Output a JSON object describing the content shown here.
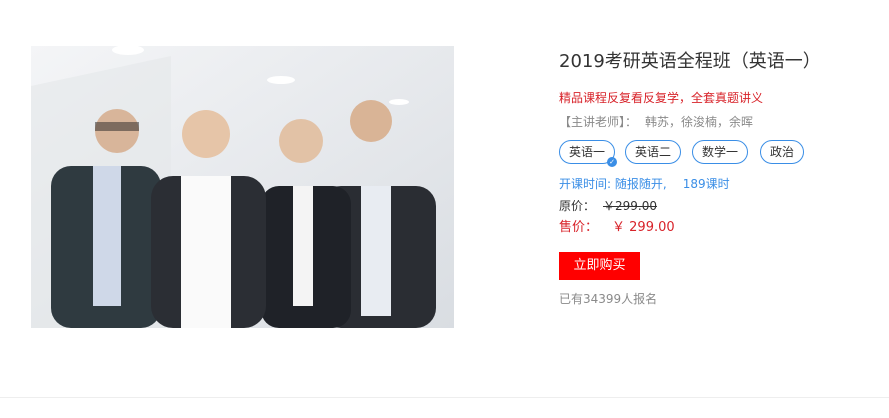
{
  "course": {
    "title": "2019考研英语全程班（英语一）",
    "subtitle": "精品课程反复看反复学，全套真题讲义",
    "teachers_label": "【主讲老师】：",
    "teachers": "韩苏，徐浚楠，余晖",
    "tags": [
      {
        "label": "英语一",
        "selected": true
      },
      {
        "label": "英语二",
        "selected": false
      },
      {
        "label": "数学一",
        "selected": false
      },
      {
        "label": "政治",
        "selected": false
      }
    ],
    "schedule": "开课时间: 随报随开,",
    "hours": "189课时",
    "original_label": "原价：",
    "original_price": "￥299.00",
    "sale_label": "售价：",
    "sale_price": "￥ 299.00",
    "buy_label": "立即购买",
    "enrolled": "已有34399人报名"
  },
  "colors": {
    "accent_red": "#ff0000",
    "price_red": "#d8232a",
    "tag_blue": "#3a8ee6"
  }
}
